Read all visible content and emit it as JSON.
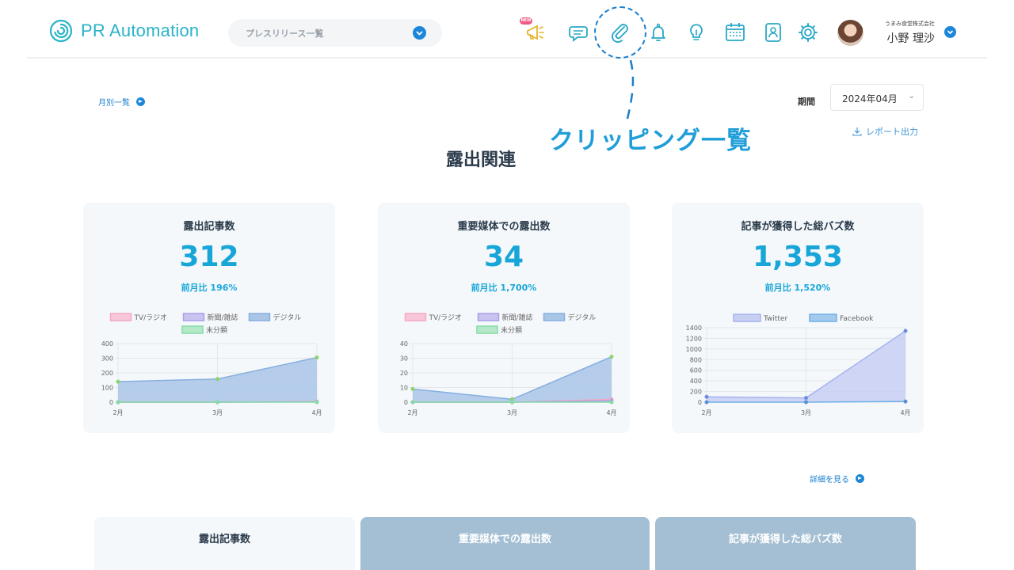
{
  "app": {
    "logo_text": "PR Automation",
    "release_selector_label": "プレスリリース一覧"
  },
  "header": {
    "icons": [
      "megaphone-icon",
      "chat-icon",
      "paperclip-icon",
      "bell-icon",
      "lightbulb-icon",
      "calendar-icon",
      "contact-card-icon",
      "gear-icon"
    ],
    "new_badge": "NEW",
    "user": {
      "company": "うまみ食堂株式会社",
      "name": "小野 理沙"
    }
  },
  "callout": {
    "label": "クリッピング一覧"
  },
  "toolbar": {
    "monthly_link": "月別一覧",
    "period_label": "期間",
    "period_value": "2024年04月",
    "report_link": "レポート出力"
  },
  "section": {
    "title": "露出関連"
  },
  "cards": [
    {
      "title": "露出記事数",
      "value": "312",
      "mom": "前月比 196%"
    },
    {
      "title": "重要媒体での露出数",
      "value": "34",
      "mom": "前月比 1,700%"
    },
    {
      "title": "記事が獲得した総バズ数",
      "value": "1,353",
      "mom": "前月比 1,520%"
    }
  ],
  "details_link": "詳細を見る",
  "tabs": [
    {
      "label": "露出記事数",
      "active": true
    },
    {
      "label": "重要媒体での露出数",
      "active": false
    },
    {
      "label": "記事が獲得した総バズ数",
      "active": false
    }
  ],
  "colors": {
    "accent": "#18a6d8",
    "link": "#1a7fd0",
    "tv_radio": "#f7c6d9",
    "newspaper": "#c9c3f0",
    "digital": "#a9c6e7",
    "uncategorized": "#b5e8c8",
    "twitter": "#c7cff3",
    "facebook": "#a3c9ec"
  },
  "chart_data": [
    {
      "type": "area",
      "categories": [
        "2月",
        "3月",
        "4月"
      ],
      "ylim": [
        0,
        400
      ],
      "yticks": [
        0,
        100,
        200,
        300,
        400
      ],
      "series": [
        {
          "name": "TV/ラジオ",
          "values": [
            0,
            0,
            5
          ]
        },
        {
          "name": "新聞/雑誌",
          "values": [
            0,
            0,
            2
          ]
        },
        {
          "name": "デジタル",
          "values": [
            140,
            158,
            305
          ]
        },
        {
          "name": "未分類",
          "values": [
            0,
            0,
            0
          ]
        }
      ],
      "legend": "top"
    },
    {
      "type": "area",
      "categories": [
        "2月",
        "3月",
        "4月"
      ],
      "ylim": [
        0,
        40
      ],
      "yticks": [
        0,
        10,
        20,
        30,
        40
      ],
      "series": [
        {
          "name": "TV/ラジオ",
          "values": [
            0,
            0,
            2
          ]
        },
        {
          "name": "新聞/雑誌",
          "values": [
            0,
            0,
            1
          ]
        },
        {
          "name": "デジタル",
          "values": [
            9,
            2,
            31
          ]
        },
        {
          "name": "未分類",
          "values": [
            0,
            0,
            0
          ]
        }
      ],
      "legend": "top"
    },
    {
      "type": "area",
      "categories": [
        "2月",
        "3月",
        "4月"
      ],
      "ylim": [
        0,
        1400
      ],
      "yticks": [
        0,
        200,
        400,
        600,
        800,
        1000,
        1200,
        1400
      ],
      "series": [
        {
          "name": "Twitter",
          "values": [
            100,
            80,
            1340
          ]
        },
        {
          "name": "Facebook",
          "values": [
            0,
            0,
            13
          ]
        }
      ],
      "legend": "top"
    }
  ]
}
